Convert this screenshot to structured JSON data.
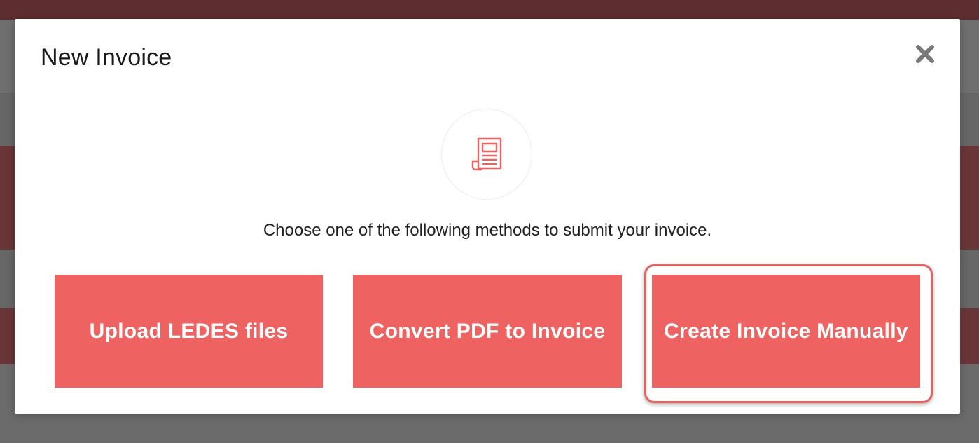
{
  "modal": {
    "title": "New Invoice",
    "close_icon": "close-icon",
    "hero_icon": "invoice-document-icon",
    "instruction": "Choose one of the following methods to submit your invoice.",
    "methods": [
      {
        "label": "Upload LEDES files"
      },
      {
        "label": "Convert PDF to Invoice"
      },
      {
        "label": "Create Invoice Manually"
      }
    ],
    "highlighted_method": "Create Invoice Manually"
  },
  "colors": {
    "accent": "#ee6361",
    "overlay": "#6b6b6b",
    "header_bar": "#5e2d30"
  }
}
